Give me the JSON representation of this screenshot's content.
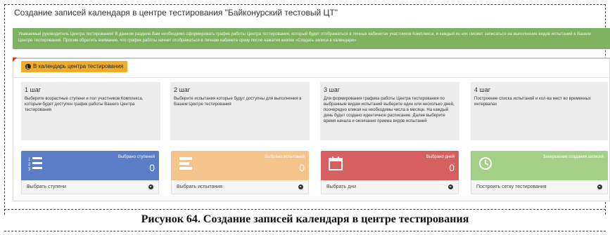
{
  "page_title": "Создание записей календаря в центре тестирования \"Байконурский тестовый ЦТ\"",
  "alert_text": "Уважаемый руководитель Центра тестирования! В данном разделе Вам необходимо сформировать график работы Центра тестирования, который будет отображаться в личных кабинетах участников Комплекса, и каждый из них сможет записаться на выполнение видов испытаний в Вашем Центре тестирования. Просим обратить внимание, что график работы начнет отображаться в личном кабинете сразу после нажатия кнопки «Создать записи в календаре»",
  "calendar_button": "В календарь центра тестирования",
  "steps": [
    {
      "title": "1 шаг",
      "desc": "Выберите возрастные ступени и пол участников Комплекса, которым будет доступен график работы Вашего Центра тестирования"
    },
    {
      "title": "2 шаг",
      "desc": "Выберите испытания которые будут доступны для выполнения в Вашем Центре тестирования"
    },
    {
      "title": "3 шаг",
      "desc": "Для формирования графика работы Центра тестирования по выбранным видам испытаний выберите один или несколько дней, поочередно кликая на необходимы числа в месяце. На каждый день будет создано идентичное расписание. Далее выберите время начала и окончания приема видов испытаний"
    },
    {
      "title": "4 шаг",
      "desc": "Построение списка испытаний и кол-ва мест во временных интервалах"
    }
  ],
  "tiles": [
    {
      "label": "Выбрано ступеней",
      "count": "0",
      "footer": "Выбрать ступени",
      "color": "#5b7cc6",
      "icon": "list-icon"
    },
    {
      "label": "Выбрано испытаний",
      "count": "0",
      "footer": "Выбрать испытания",
      "color": "#f4c48a",
      "icon": "bars-icon"
    },
    {
      "label": "Выбрано дней",
      "count": "0",
      "footer": "Выбрать дни",
      "color": "#d66060",
      "icon": "calendar-icon"
    },
    {
      "label": "Завершение создания записей",
      "count": "",
      "footer": "Построить сетку тестирования",
      "color": "#a4cf86",
      "icon": "clock-icon"
    }
  ],
  "caption": "Рисунок 64. Создание записей календаря в центре тестирования"
}
